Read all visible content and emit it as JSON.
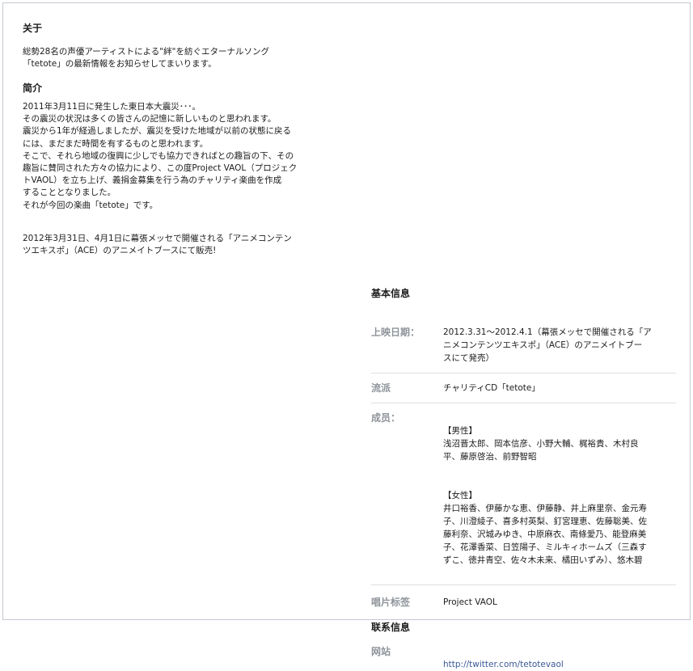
{
  "about": {
    "title": "关于",
    "description": "総勢28名の声優アーティストによる\"絆\"を紡ぐエターナルソング\n「tetote」の最新情報をお知らせしてまいります。"
  },
  "intro": {
    "title": "简介",
    "body": "2011年3月11日に発生した東日本大震災･･･。\nその震災の状況は多くの皆さんの記憶に新しいものと思われます。\n震災から1年が経過しましたが、震災を受けた地域が以前の状態に戻る\nには、まだまだ時間を有するものと思われます。\nそこで、それら地域の復興に少しでも協力できればとの趣旨の下、その\n趣旨に賛同された方々の協力により、この度Project VAOL（プロジェク\nトVAOL）を立ち上げ、義捐金募集を行う為のチャリティ楽曲を作成\nすることとなりました。\nそれが今回の楽曲「tetote」です。",
    "sale": "2012年3月31日、4月1日に幕張メッセで開催される「アニメコンテン\nツエキスポ」（ACE）のアニメイトブースにて販売!"
  },
  "basic_info": {
    "title": "基本信息",
    "release_date": {
      "label": "上映日期：",
      "value": "2012.3.31〜2012.4.1（幕張メッセで開催される「ア\nニメコンテンツエキスポ」（ACE）のアニメイトブー\nスにて発売）"
    },
    "genre": {
      "label": "流派",
      "value": "チャリティCD「tetote」"
    },
    "members": {
      "label": "成员：",
      "male": "【男性】\n浅沼晋太郎、岡本信彦、小野大輔、梶裕貴、木村良\n平、藤原啓治、前野智昭",
      "female": "【女性】\n井口裕香、伊藤かな恵、伊藤静、井上麻里奈、金元寿\n子、川澄綾子、喜多村英梨、釘宮理恵、佐藤聡美、佐\n藤利奈、沢城みゆき、中原麻衣、南條愛乃、能登麻美\n子、花澤香菜、日笠陽子、ミルキィホームズ（三森す\nずこ、徳井青空、佐々木未来、橘田いずみ）、悠木碧"
    },
    "record_label": {
      "label": "唱片标签",
      "value": "Project VAOL"
    }
  },
  "contact": {
    "title": "联系信息",
    "website": {
      "label": "网站",
      "url": "http://twitter.com/tetotevaol"
    }
  }
}
